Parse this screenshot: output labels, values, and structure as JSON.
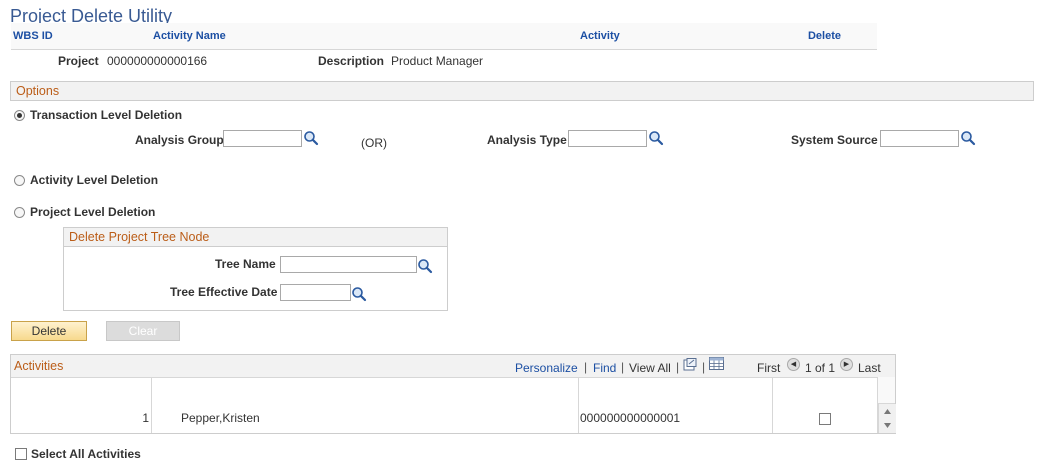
{
  "page": {
    "title": "Project Delete Utility",
    "project_label": "Project",
    "project_value": "000000000000166",
    "description_label": "Description",
    "description_value": "Product Manager"
  },
  "options": {
    "header": "Options",
    "transaction_label": "Transaction Level Deletion",
    "analysis_group_label": "Analysis Group",
    "analysis_group_value": "",
    "or_text": "(OR)",
    "analysis_type_label": "Analysis Type",
    "analysis_type_value": "",
    "system_source_label": "System Source",
    "system_source_value": "",
    "activity_label": "Activity Level Deletion",
    "project_label": "Project Level Deletion",
    "selected": "transaction"
  },
  "tree": {
    "header": "Delete Project Tree Node",
    "tree_name_label": "Tree Name",
    "tree_name_value": "",
    "effdt_label": "Tree Effective Date",
    "effdt_value": ""
  },
  "buttons": {
    "delete": "Delete",
    "clear": "Clear"
  },
  "activities": {
    "title": "Activities",
    "personalize": "Personalize",
    "sep1": "|",
    "find": "Find",
    "sep2": "|",
    "view_all": "View All",
    "sep3": "|",
    "sep4": "|",
    "first": "First",
    "range": "1 of 1",
    "last": "Last",
    "columns": [
      "WBS ID",
      "Activity Name",
      "Activity",
      "Delete"
    ],
    "rows": [
      {
        "wbs_id": "1",
        "activity_name": "Pepper,Kristen",
        "activity": "000000000000001",
        "delete": false
      }
    ],
    "select_all_label": "Select All Activities"
  },
  "colors": {
    "title": "#395a93",
    "section_header": "#bb5d18",
    "link": "#1c4fa3"
  }
}
